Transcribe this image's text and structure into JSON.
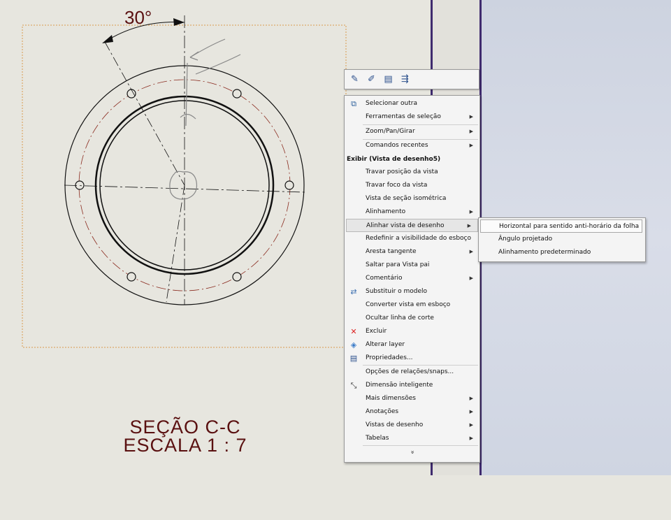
{
  "drawing": {
    "angle_label": "30°",
    "caption_line1": "SEÇÃO C-C",
    "caption_line2": "ESCALA 1 : 7"
  },
  "toolbar": {
    "icons": [
      "open-part-icon",
      "edit-sketch-icon",
      "layers-icon",
      "align-icon"
    ]
  },
  "menu": {
    "group1": [
      {
        "label": "Selecionar outra",
        "icon": "select-other-icon",
        "submenu": false
      },
      {
        "label": "Ferramentas de seleção",
        "submenu": true
      },
      {
        "label": "Zoom/Pan/Girar",
        "submenu": true
      },
      {
        "label": "Comandos recentes",
        "submenu": true
      }
    ],
    "section_title": "Exibir (Vista de desenho5)",
    "group2": [
      {
        "label": "Travar posição da vista",
        "submenu": false
      },
      {
        "label": "Travar foco da vista",
        "submenu": false
      },
      {
        "label": "Vista de seção isométrica",
        "submenu": false
      },
      {
        "label": "Alinhamento",
        "submenu": true
      },
      {
        "label": "Alinhar vista de desenho",
        "submenu": true,
        "highlighted": true
      },
      {
        "label": "Redefinir a visibilidade do esboço",
        "submenu": false
      },
      {
        "label": "Aresta tangente",
        "submenu": true
      },
      {
        "label": "Saltar para Vista pai",
        "submenu": false
      },
      {
        "label": "Comentário",
        "submenu": true
      },
      {
        "label": "Substituir o modelo",
        "icon": "replace-model-icon",
        "submenu": false
      },
      {
        "label": "Converter vista em esboço",
        "submenu": false
      },
      {
        "label": "Ocultar linha de corte",
        "submenu": false
      },
      {
        "label": "Excluir",
        "icon": "delete-icon",
        "submenu": false
      },
      {
        "label": "Alterar layer",
        "icon": "layer-icon",
        "submenu": false
      },
      {
        "label": "Propriedades...",
        "icon": "properties-icon",
        "submenu": false
      }
    ],
    "group3": [
      {
        "label": "Opções de relações/snaps...",
        "submenu": false
      },
      {
        "label": "Dimensão inteligente",
        "icon": "smart-dimension-icon",
        "submenu": false
      },
      {
        "label": "Mais dimensões",
        "submenu": true
      },
      {
        "label": "Anotações",
        "submenu": true
      },
      {
        "label": "Vistas de desenho",
        "submenu": true
      },
      {
        "label": "Tabelas",
        "submenu": true
      }
    ],
    "more_glyph": "»"
  },
  "submenu": {
    "items": [
      {
        "label": "Horizontal para sentido anti-horário da folha",
        "highlighted": true
      },
      {
        "label": "Ângulo projetado"
      },
      {
        "label": "Alinhamento predeterminado"
      }
    ]
  }
}
